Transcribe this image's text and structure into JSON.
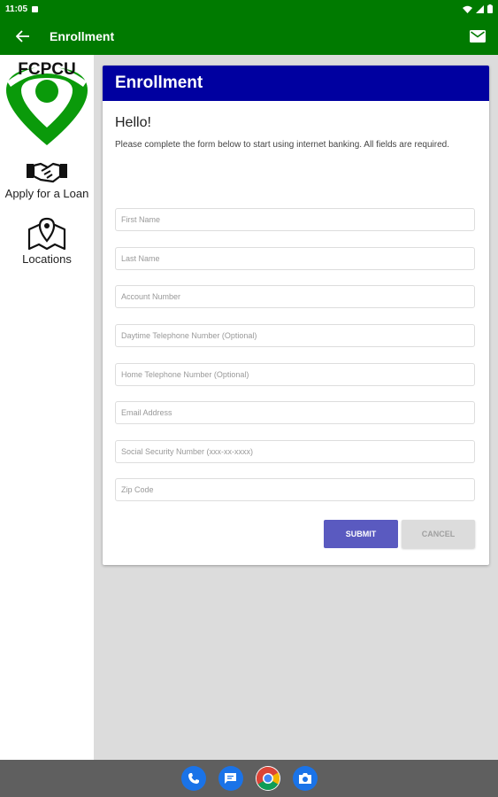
{
  "status": {
    "time": "11:05"
  },
  "appbar": {
    "title": "Enrollment"
  },
  "sidebar": {
    "logo_text": "FCPCU",
    "items": [
      {
        "label": "Apply for a Loan",
        "icon": "handshake-icon"
      },
      {
        "label": "Locations",
        "icon": "map-pin-icon"
      }
    ]
  },
  "card": {
    "title": "Enrollment",
    "greeting": "Hello!",
    "intro": "Please complete the form below to start using internet banking. All fields are required."
  },
  "fields": [
    {
      "placeholder": "First Name",
      "value": ""
    },
    {
      "placeholder": "Last Name",
      "value": ""
    },
    {
      "placeholder": "Account Number",
      "value": ""
    },
    {
      "placeholder": "Daytime Telephone Number (Optional)",
      "value": ""
    },
    {
      "placeholder": "Home Telephone Number (Optional)",
      "value": ""
    },
    {
      "placeholder": "Email Address",
      "value": ""
    },
    {
      "placeholder": "Social Security Number (xxx-xx-xxxx)",
      "value": ""
    },
    {
      "placeholder": "Zip Code",
      "value": ""
    }
  ],
  "buttons": {
    "submit": "SUBMIT",
    "cancel": "CANCEL"
  },
  "colors": {
    "brand_green": "#007a00",
    "header_blue": "#0000a0",
    "submit_purple": "#5a5ac0"
  },
  "dock": [
    "phone-icon",
    "messages-icon",
    "chrome-icon",
    "camera-icon"
  ]
}
